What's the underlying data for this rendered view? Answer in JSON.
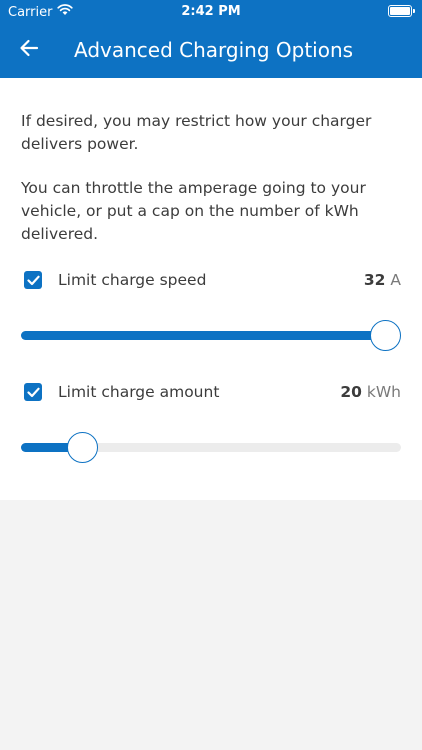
{
  "status_bar": {
    "carrier": "Carrier",
    "time": "2:42 PM"
  },
  "header": {
    "title": "Advanced Charging Options",
    "background": "#0d72c3"
  },
  "description": {
    "paragraph_1": "If desired, you may restrict how your charger delivers power.",
    "paragraph_2": "You can throttle the amperage going to your vehicle, or put a cap on the number of kWh delivered."
  },
  "options": {
    "charge_speed": {
      "label": "Limit charge speed",
      "checked": true,
      "value": "32",
      "unit": "A",
      "slider_fraction": 1.0
    },
    "charge_amount": {
      "label": "Limit charge amount",
      "checked": true,
      "value": "20",
      "unit": "kWh",
      "slider_fraction": 0.13
    }
  },
  "colors": {
    "accent": "#0d72c3",
    "track": "#ececec",
    "page_background": "#f3f3f3"
  }
}
